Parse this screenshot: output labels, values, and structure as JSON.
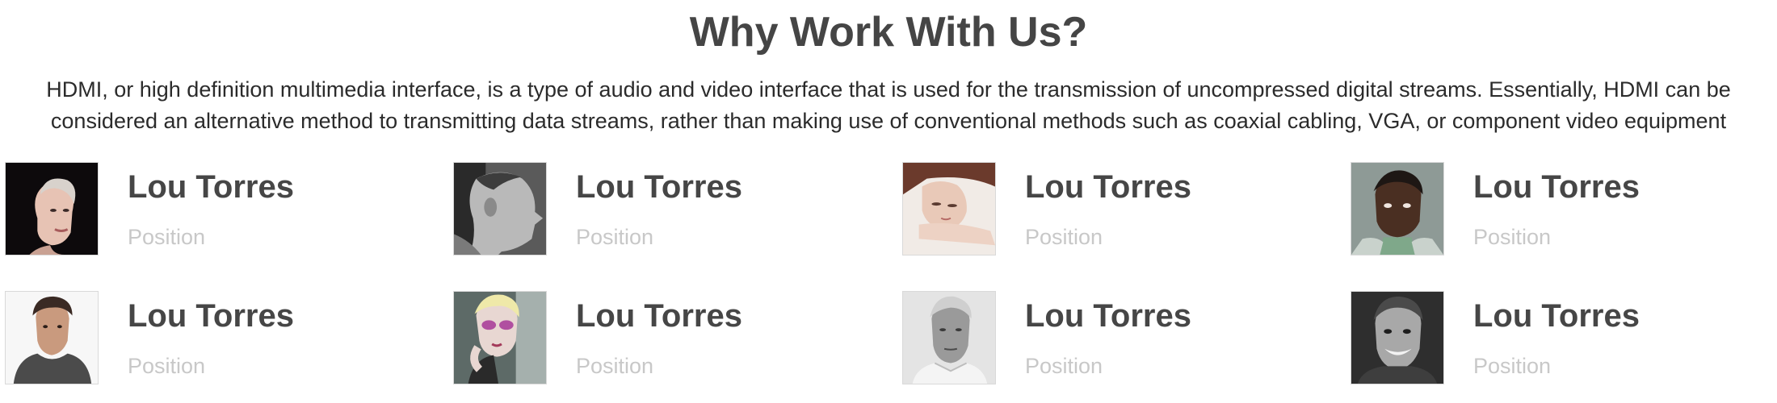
{
  "section": {
    "title": "Why Work With Us?",
    "description_line1": "HDMI, or high definition multimedia interface, is a type of audio and video interface that is used for the transmission of uncompressed digital streams. Essentially, HDMI can be",
    "description_line2": "considered an alternative method to transmitting data streams, rather than making use of conventional methods such as coaxial cabling, VGA, or component video equipment"
  },
  "team": [
    {
      "name": "Lou Torres",
      "position": "Position",
      "photo_icon": "woman-short-hair-portrait"
    },
    {
      "name": "Lou Torres",
      "position": "Position",
      "photo_icon": "man-profile-portrait"
    },
    {
      "name": "Lou Torres",
      "position": "Position",
      "photo_icon": "woman-resting-portrait"
    },
    {
      "name": "Lou Torres",
      "position": "Position",
      "photo_icon": "man-braids-portrait"
    },
    {
      "name": "Lou Torres",
      "position": "Position",
      "photo_icon": "young-man-hoodie-portrait"
    },
    {
      "name": "Lou Torres",
      "position": "Position",
      "photo_icon": "woman-face-paint-portrait"
    },
    {
      "name": "Lou Torres",
      "position": "Position",
      "photo_icon": "elderly-man-portrait"
    },
    {
      "name": "Lou Torres",
      "position": "Position",
      "photo_icon": "man-smiling-portrait"
    }
  ],
  "colors": {
    "heading": "#454545",
    "body_text": "#2b2b2b",
    "name": "#464646",
    "position": "#c8c8c8"
  }
}
